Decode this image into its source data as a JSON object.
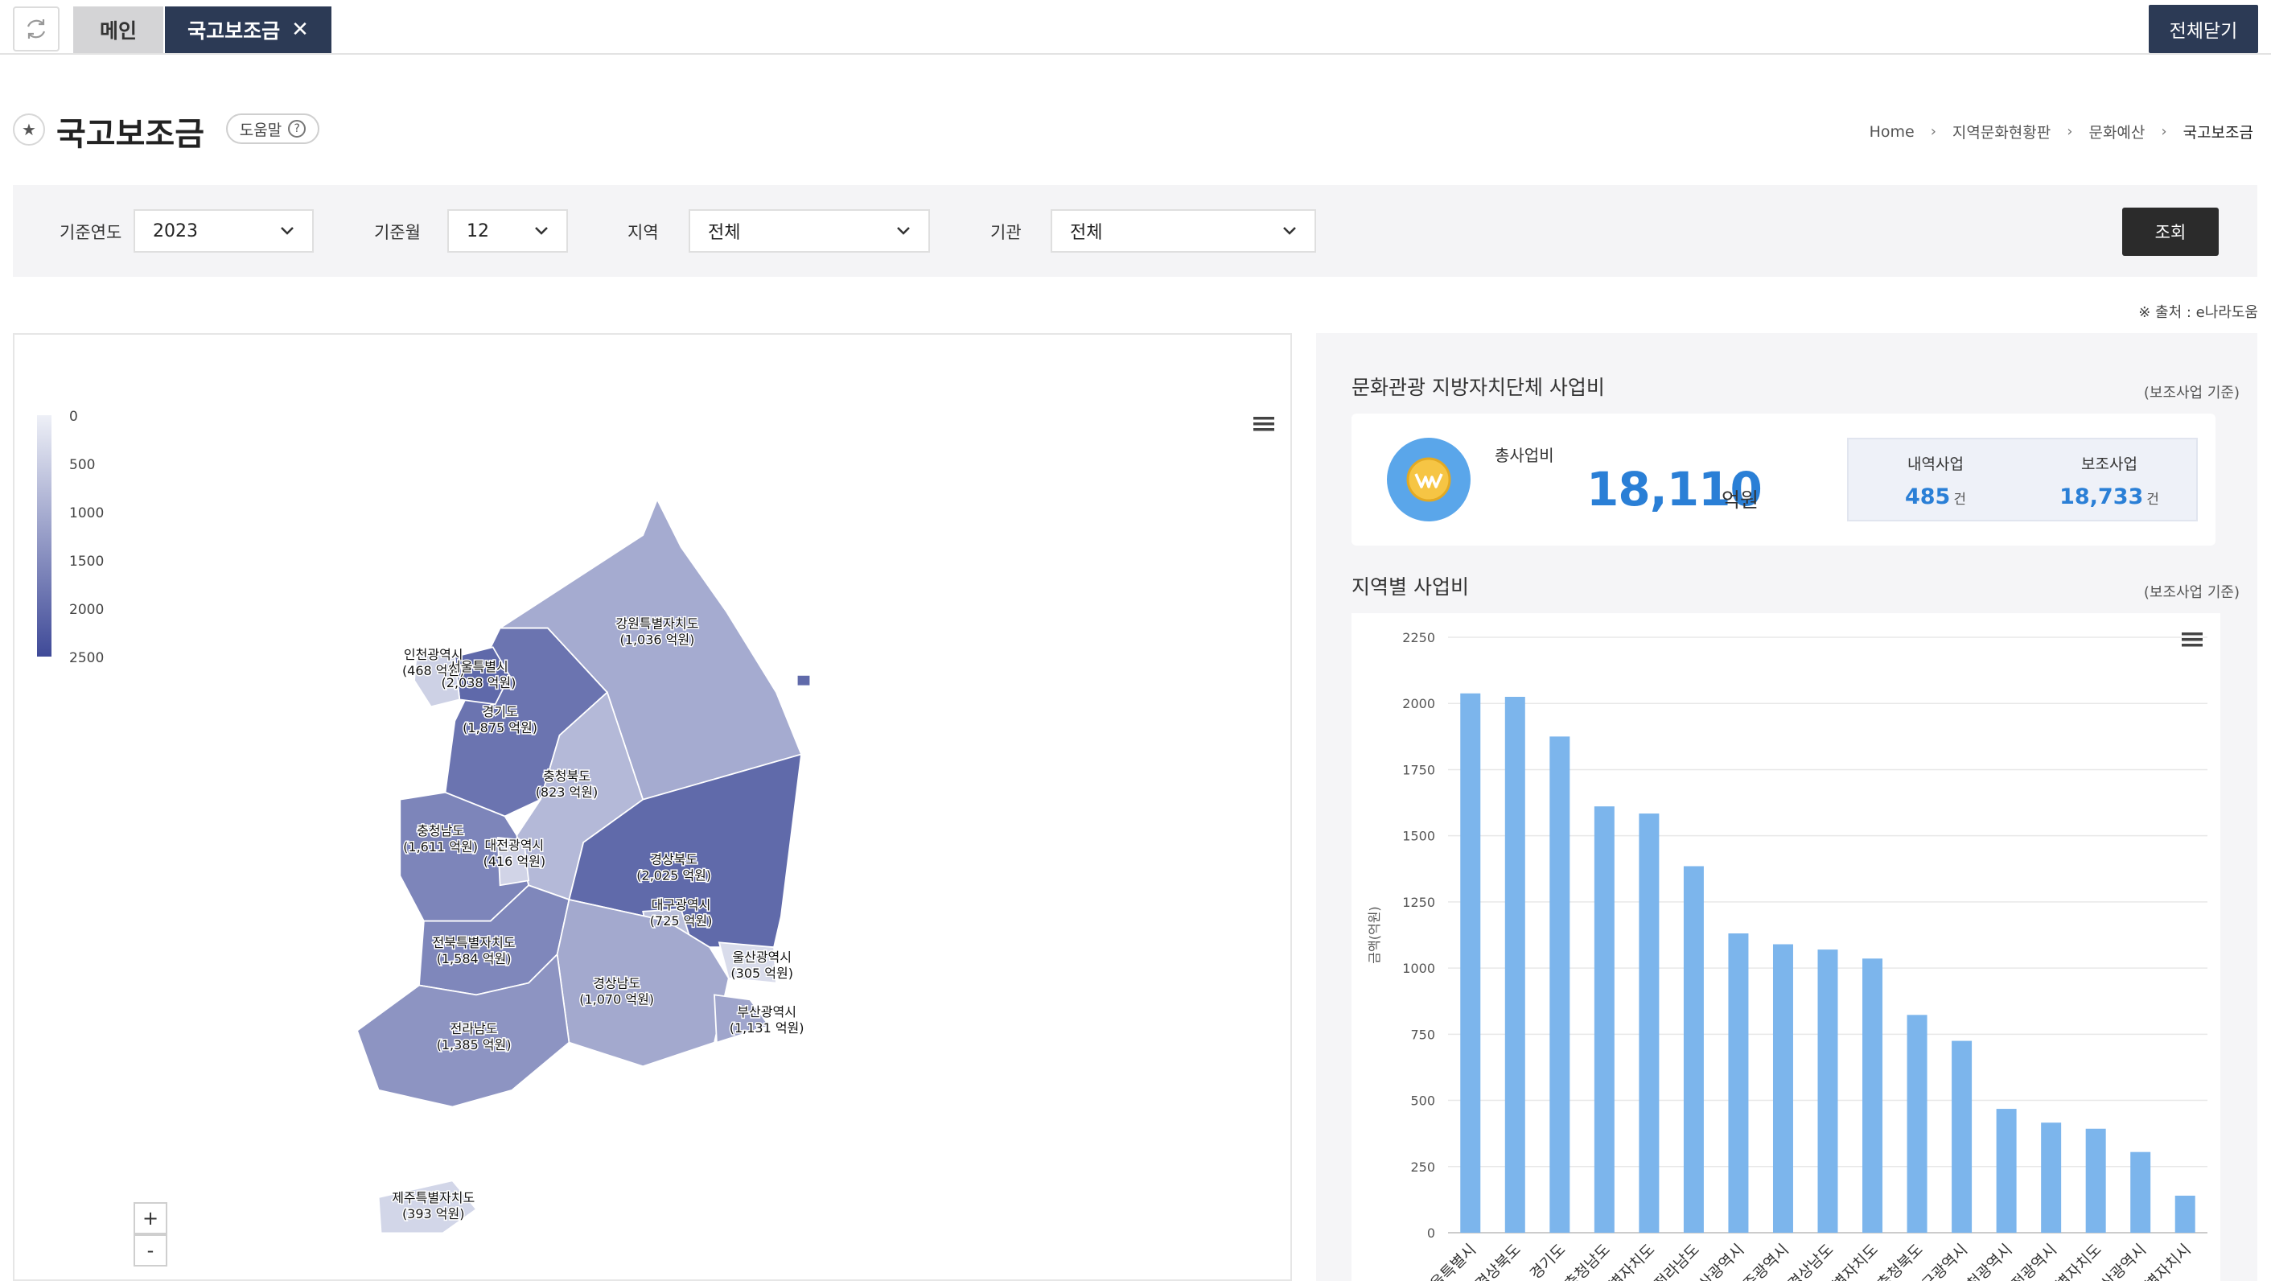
{
  "tabs": {
    "main_label": "메인",
    "active_label": "국고보조금",
    "close_all_label": "전체닫기"
  },
  "page": {
    "title": "국고보조금",
    "help_label": "도움말"
  },
  "breadcrumb": {
    "items": [
      "Home",
      "지역문화현황판",
      "문화예산",
      "국고보조금"
    ]
  },
  "filters": {
    "year_label": "기준연도",
    "year_value": "2023",
    "month_label": "기준월",
    "month_value": "12",
    "region_label": "지역",
    "region_value": "전체",
    "org_label": "기관",
    "org_value": "전체",
    "search_label": "조회"
  },
  "source_note": "※ 출처 : e나라도움",
  "map": {
    "legend": [
      "0",
      "500",
      "1000",
      "1500",
      "2000",
      "2500"
    ],
    "zoom_in": "+",
    "zoom_out": "-",
    "regions": [
      {
        "name": "인천광역시",
        "amount": "(468 억원)",
        "value": 468
      },
      {
        "name": "서울특별시",
        "amount": "(2,038 억원)",
        "value": 2038
      },
      {
        "name": "경기도",
        "amount": "(1,875 억원)",
        "value": 1875
      },
      {
        "name": "강원특별자치도",
        "amount": "(1,036 억원)",
        "value": 1036
      },
      {
        "name": "충청북도",
        "amount": "(823 억원)",
        "value": 823
      },
      {
        "name": "충청남도",
        "amount": "(1,611 억원)",
        "value": 1611
      },
      {
        "name": "대전광역시",
        "amount": "(416 억원)",
        "value": 416
      },
      {
        "name": "경상북도",
        "amount": "(2,025 억원)",
        "value": 2025
      },
      {
        "name": "대구광역시",
        "amount": "(725 억원)",
        "value": 725
      },
      {
        "name": "전북특별자치도",
        "amount": "(1,584 억원)",
        "value": 1584
      },
      {
        "name": "울산광역시",
        "amount": "(305 억원)",
        "value": 305
      },
      {
        "name": "경상남도",
        "amount": "(1,070 억원)",
        "value": 1070
      },
      {
        "name": "부산광역시",
        "amount": "(1,131 억원)",
        "value": 1131
      },
      {
        "name": "전라남도",
        "amount": "(1,385 억원)",
        "value": 1385
      },
      {
        "name": "제주특별자치도",
        "amount": "(393 억원)",
        "value": 393
      }
    ]
  },
  "summary": {
    "title": "문화관광 지방자치단체 사업비",
    "note": "(보조사업 기준)",
    "total_label": "총사업비",
    "total_value": "18,110",
    "total_unit": "억원",
    "detail_label": "내역사업",
    "detail_value": "485",
    "subsidy_label": "보조사업",
    "subsidy_value": "18,733",
    "count_unit": "건"
  },
  "regional": {
    "title": "지역별 사업비",
    "note": "(보조사업 기준)"
  },
  "colors": {
    "accent": "#2a7fd6",
    "bar": "#7cb5ec",
    "dark": "#2c3a55"
  },
  "chart_data": {
    "type": "bar",
    "ylabel": "금액(억원)",
    "ylim": [
      0,
      2250
    ],
    "yticks": [
      0,
      250,
      500,
      750,
      1000,
      1250,
      1500,
      1750,
      2000,
      2250
    ],
    "categories": [
      "서울특별시",
      "경상북도",
      "경기도",
      "충청남도",
      "전북특별자치도",
      "전라남도",
      "부산광역시",
      "광주광역시",
      "경상남도",
      "강원특별자치도",
      "충청북도",
      "대구광역시",
      "인천광역시",
      "대전광역시",
      "제주특별자치도",
      "울산광역시",
      "세종특별자치시"
    ],
    "values": [
      2038,
      2025,
      1875,
      1611,
      1584,
      1385,
      1131,
      1090,
      1070,
      1036,
      823,
      725,
      468,
      416,
      393,
      305,
      140
    ]
  }
}
